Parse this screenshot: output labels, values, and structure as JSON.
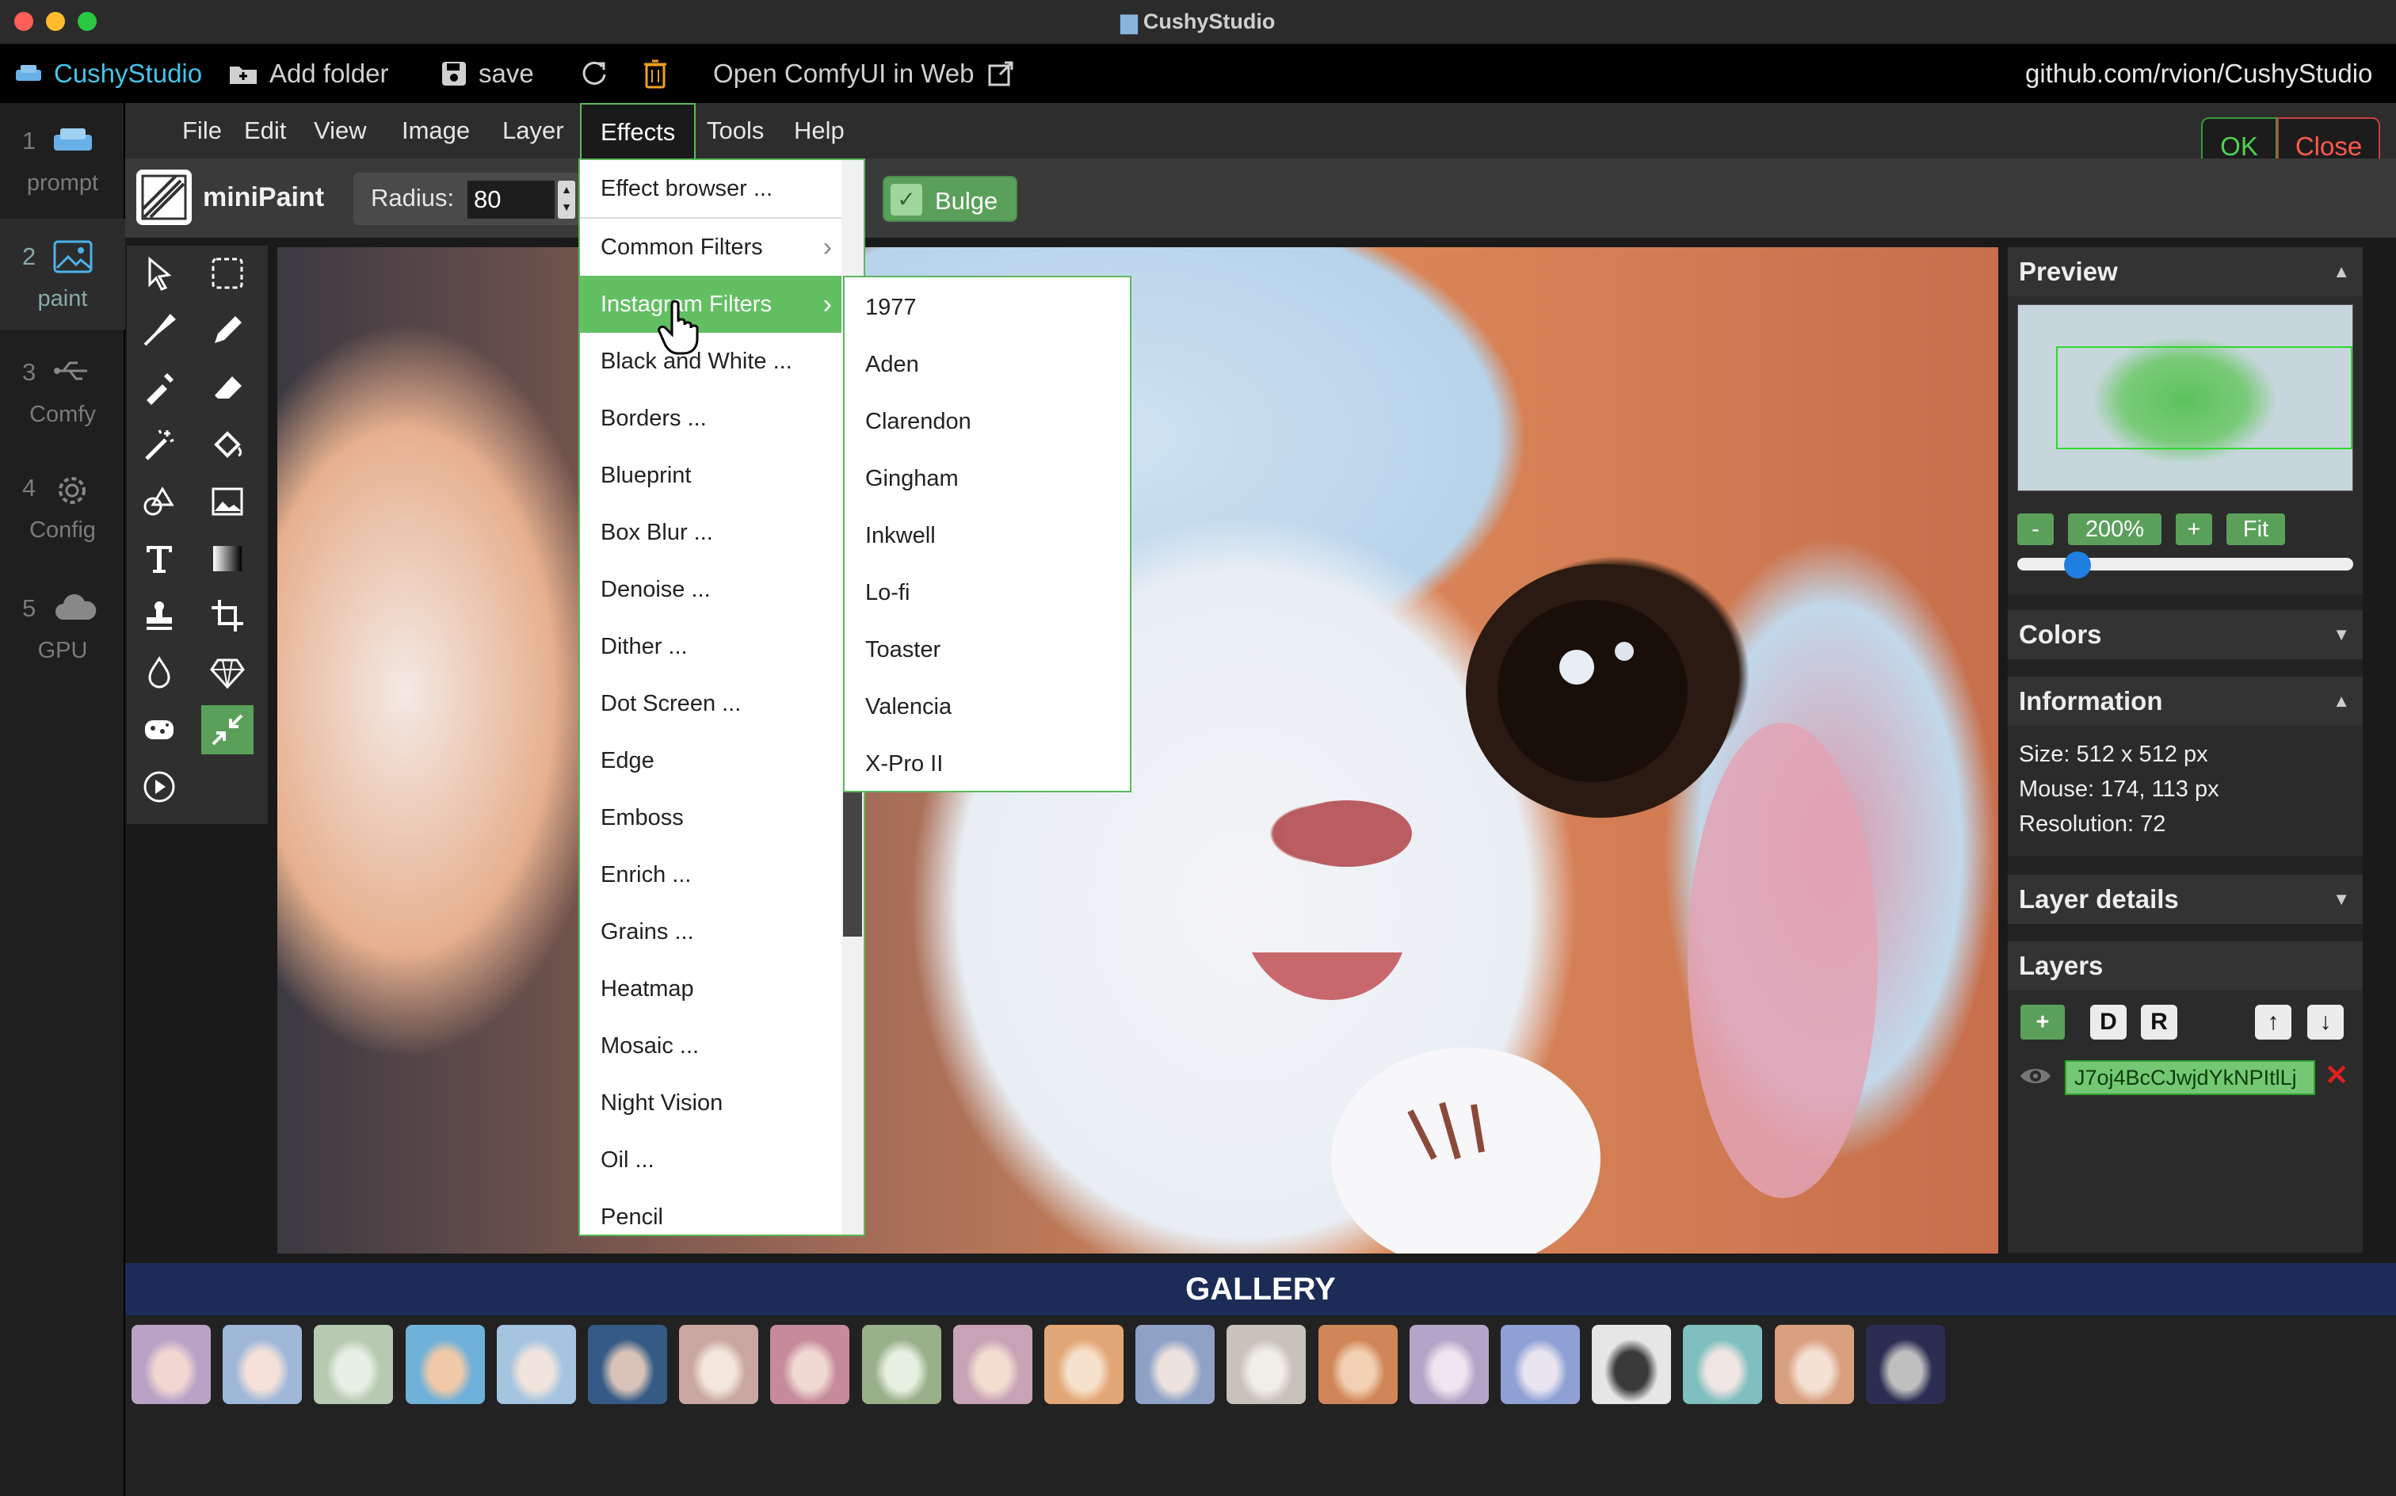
{
  "window": {
    "title": "CushyStudio"
  },
  "appbar": {
    "app_name": "CushyStudio",
    "add_folder": "Add folder",
    "save": "save",
    "open_comfy": "Open ComfyUI in Web",
    "repo": "github.com/rvion/CushyStudio"
  },
  "sidebar": {
    "items": [
      {
        "num": "1",
        "label": "prompt"
      },
      {
        "num": "2",
        "label": "paint"
      },
      {
        "num": "3",
        "label": "Comfy"
      },
      {
        "num": "4",
        "label": "Config"
      },
      {
        "num": "5",
        "label": "GPU"
      }
    ]
  },
  "menubar": {
    "items": [
      "File",
      "Edit",
      "View",
      "Image",
      "Layer",
      "Effects",
      "Tools",
      "Help"
    ],
    "ok": "OK",
    "close": "Close"
  },
  "options": {
    "brand": "miniPaint",
    "radius_label": "Radius:",
    "radius_value": "80",
    "bulge_label": "Bulge"
  },
  "effects_menu": {
    "items": [
      "Effect browser ...",
      "Common Filters",
      "Instagram Filters",
      "Black and White ...",
      "Borders ...",
      "Blueprint",
      "Box Blur ...",
      "Denoise ...",
      "Dither ...",
      "Dot Screen ...",
      "Edge",
      "Emboss",
      "Enrich ...",
      "Grains ...",
      "Heatmap",
      "Mosaic ...",
      "Night Vision",
      "Oil ...",
      "Pencil"
    ]
  },
  "instagram_menu": {
    "items": [
      "1977",
      "Aden",
      "Clarendon",
      "Gingham",
      "Inkwell",
      "Lo-fi",
      "Toaster",
      "Valencia",
      "X-Pro II"
    ]
  },
  "panels": {
    "preview": {
      "title": "Preview",
      "zoom_minus": "-",
      "zoom": "200%",
      "zoom_plus": "+",
      "fit": "Fit",
      "zoom_slider_fraction": 0.18
    },
    "colors": {
      "title": "Colors"
    },
    "information": {
      "title": "Information",
      "size": "Size: 512 x 512 px",
      "mouse": "Mouse: 174, 113 px",
      "resolution": "Resolution: 72"
    },
    "layer_details": {
      "title": "Layer details"
    },
    "layers": {
      "title": "Layers",
      "add": "+",
      "d": "D",
      "r": "R",
      "up": "↑",
      "down": "↓",
      "layer_name": "J7oj4BcCJwjdYkNPItlLj",
      "delete": "✕"
    }
  },
  "gallery": {
    "title": "GALLERY",
    "count": 20
  },
  "colors": {
    "accent": "#5aa05a",
    "highlight": "#62bf62",
    "gallery_bg": "#1c2c57",
    "ok": "#4fd24f",
    "close": "#ff5a4a"
  }
}
